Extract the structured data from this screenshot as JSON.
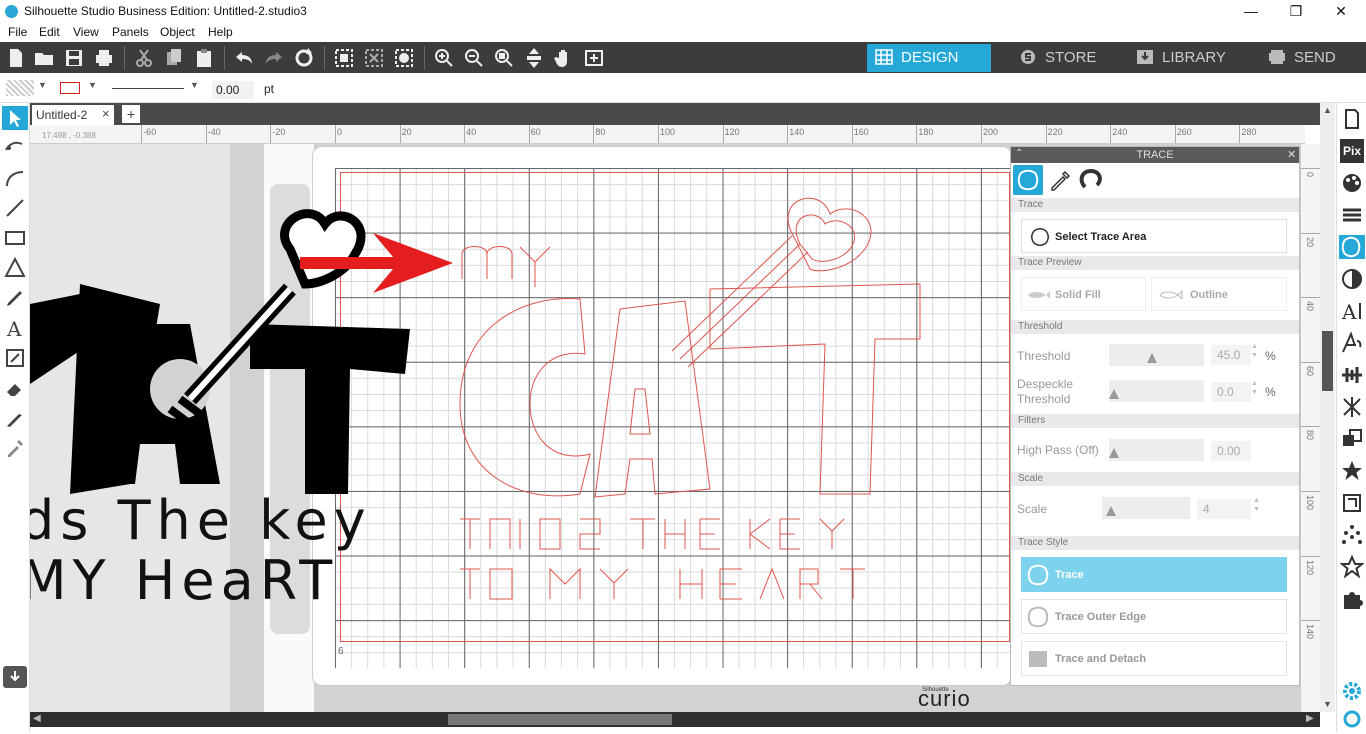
{
  "window": {
    "title": "Silhouette Studio Business Edition: Untitled-2.studio3",
    "minimize": "—",
    "restore": "❐",
    "close": "✕"
  },
  "menu": [
    "File",
    "Edit",
    "View",
    "Panels",
    "Object",
    "Help"
  ],
  "nav_tabs": [
    {
      "label": "DESIGN",
      "icon": "grid-icon",
      "active": true
    },
    {
      "label": "STORE",
      "icon": "store-s-icon",
      "active": false
    },
    {
      "label": "LIBRARY",
      "icon": "library-download-icon",
      "active": false
    },
    {
      "label": "SEND",
      "icon": "send-machine-icon",
      "active": false
    }
  ],
  "props": {
    "line_width": "0.00",
    "unit": "pt"
  },
  "doc_tab": {
    "name": "Untitled-2",
    "close": "×",
    "add": "+"
  },
  "rulers": {
    "h_ticks": [
      "-60",
      "-40",
      "-20",
      "0",
      "20",
      "40",
      "60",
      "80",
      "100",
      "120",
      "140",
      "160",
      "180",
      "200",
      "220",
      "240",
      "260",
      "280"
    ],
    "v_ticks": [
      "0",
      "20",
      "40",
      "60",
      "80",
      "100",
      "120",
      "140"
    ],
    "coords": "17.498 , -0.388"
  },
  "canvas": {
    "source_text_1": "ds The key",
    "source_text_2": "MY HeaRT",
    "page_number": "6",
    "brand_small": "Silhouette",
    "brand": "curio"
  },
  "trace_panel": {
    "title": "TRACE",
    "close": "✕",
    "section_trace": "Trace",
    "select_area": "Select Trace Area",
    "section_preview": "Trace Preview",
    "solid_fill": "Solid Fill",
    "outline": "Outline",
    "section_threshold": "Threshold",
    "threshold_label": "Threshold",
    "threshold_value": "45.0",
    "threshold_unit": "%",
    "despeckle_label_1": "Despeckle",
    "despeckle_label_2": "Threshold",
    "despeckle_value": "0.0",
    "despeckle_unit": "%",
    "section_filters": "Filters",
    "highpass_label": "High Pass (Off)",
    "highpass_value": "0.00",
    "section_scale": "Scale",
    "scale_label": "Scale",
    "scale_value": "4",
    "section_style": "Trace Style",
    "style_trace": "Trace",
    "style_outer": "Trace Outer Edge",
    "style_detach": "Trace and Detach",
    "threshold_level": 0.45,
    "despeckle_level": 0.0,
    "highpass_level": 0.0,
    "scale_level": 0.05
  },
  "colors": {
    "accent": "#25a8d8",
    "trace_line": "#e0544e",
    "arrow": "#e41e1e"
  }
}
